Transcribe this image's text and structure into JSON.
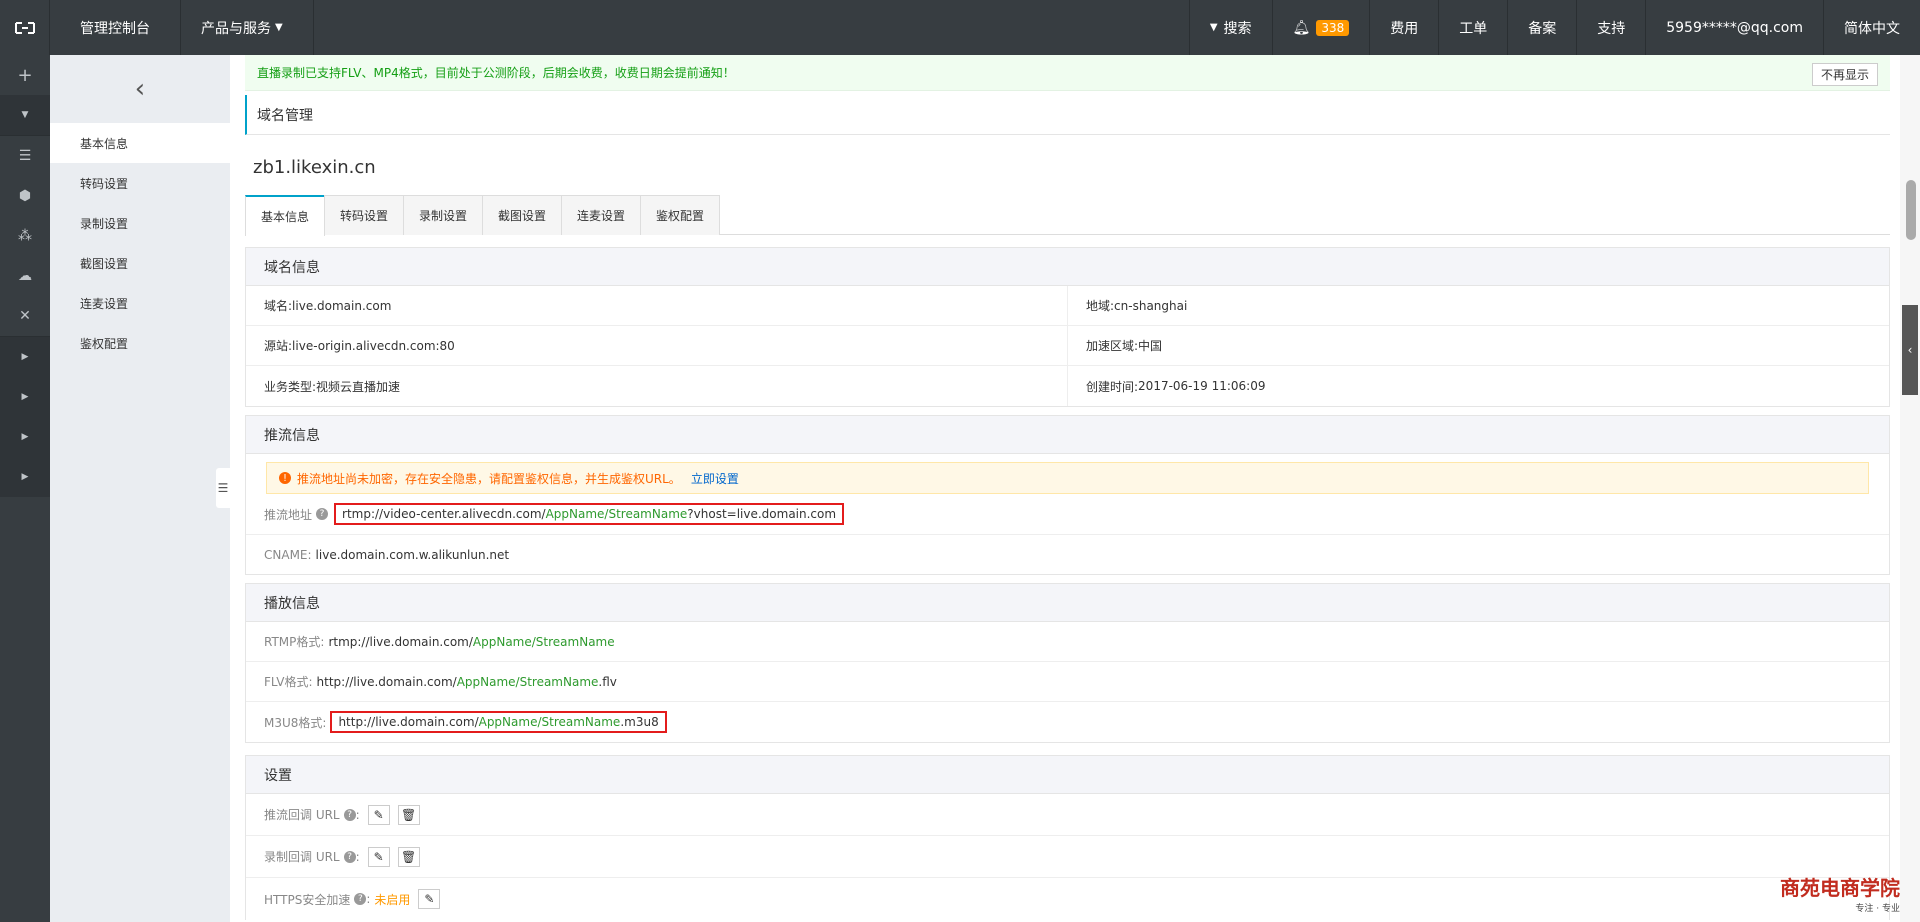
{
  "topbar": {
    "console": "管理控制台",
    "products": "产品与服务",
    "search": "搜索",
    "notif_count": "338",
    "fees": "费用",
    "tickets": "工单",
    "filing": "备案",
    "support": "支持",
    "user": "5959*****@qq.com",
    "lang": "简体中文"
  },
  "sidenav": {
    "items": [
      {
        "label": "基本信息"
      },
      {
        "label": "转码设置"
      },
      {
        "label": "录制设置"
      },
      {
        "label": "截图设置"
      },
      {
        "label": "连麦设置"
      },
      {
        "label": "鉴权配置"
      }
    ]
  },
  "notice": {
    "text": "直播录制已支持FLV、MP4格式，目前处于公测阶段，后期会收费，收费日期会提前通知！",
    "dismiss": "不再显示"
  },
  "breadcrumb": "域名管理",
  "domain_title": "zb1.likexin.cn",
  "tabs": [
    {
      "label": "基本信息"
    },
    {
      "label": "转码设置"
    },
    {
      "label": "录制设置"
    },
    {
      "label": "截图设置"
    },
    {
      "label": "连麦设置"
    },
    {
      "label": "鉴权配置"
    }
  ],
  "domain_info": {
    "title": "域名信息",
    "domain_label": "域名:",
    "domain": "live.domain.com",
    "region_label": "地域:",
    "region": "cn-shanghai",
    "origin_label": "源站:",
    "origin": "live-origin.alivecdn.com:80",
    "accel_label": "加速区域:",
    "accel": "中国",
    "biz_label": "业务类型:",
    "biz": "视频云直播加速",
    "created_label": "创建时间:",
    "created": "2017-06-19 11:06:09"
  },
  "push_info": {
    "title": "推流信息",
    "warn": "推流地址尚未加密，存在安全隐患，请配置鉴权信息，并生成鉴权URL。",
    "warn_link": "立即设置",
    "url_label": "推流地址",
    "url_a": "rtmp://video-center.alivecdn.com/",
    "url_b": "AppName/StreamName",
    "url_c": "?vhost=live.domain.com",
    "cname_label": "CNAME:",
    "cname": "live.domain.com.w.alikunlun.net"
  },
  "play_info": {
    "title": "播放信息",
    "rtmp_label": "RTMP格式:",
    "rtmp_a": "rtmp://live.domain.com/",
    "rtmp_b": "AppName/StreamName",
    "flv_label": "FLV格式:",
    "flv_a": "http://live.domain.com/",
    "flv_b": "AppName/StreamName",
    "flv_c": ".flv",
    "m3u8_label": "M3U8格式:",
    "m3u8_a": "http://live.domain.com/",
    "m3u8_b": "AppName/StreamName",
    "m3u8_c": ".m3u8"
  },
  "settings": {
    "title": "设置",
    "push_cb": "推流回调 URL",
    "rec_cb": "录制回调 URL",
    "https": "HTTPS安全加速",
    "https_status": "未启用",
    "colon": ":"
  },
  "brand": {
    "name": "商苑电商学院",
    "sub": "专注 · 专业"
  }
}
